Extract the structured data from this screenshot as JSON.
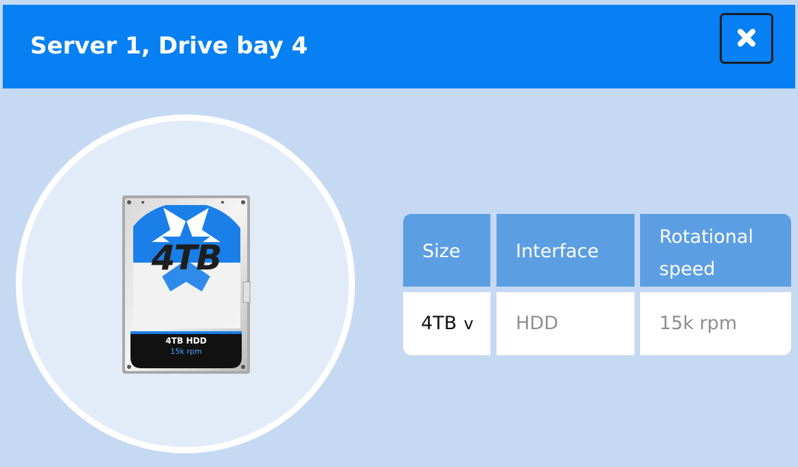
{
  "dialog": {
    "title": "Server 1, Drive bay 4",
    "close_icon": "close-icon"
  },
  "drive": {
    "image_icon": "hard-drive-icon",
    "big_label": "4TB",
    "label_size": "4TB HDD",
    "label_speed": "15k rpm",
    "colors": {
      "star_bg": "#1a7fe8",
      "circle_bg": "#e2ecf9"
    }
  },
  "table": {
    "headers": [
      "Size",
      "Interface",
      "Rotational speed"
    ],
    "row": {
      "size": "4TB",
      "size_chevron": "v",
      "interface": "HDD",
      "speed": "15k rpm"
    }
  },
  "colors": {
    "header_bg": "#0680f3",
    "panel_bg": "#c5d9f3",
    "table_header_bg": "#5c9ee2"
  }
}
